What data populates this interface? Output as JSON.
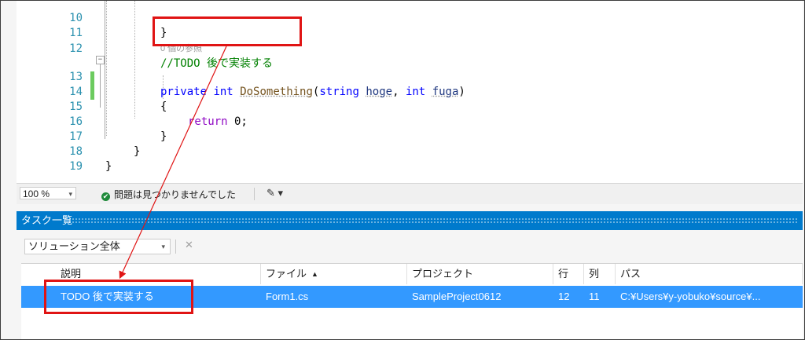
{
  "editor": {
    "lines": [
      {
        "num": "10",
        "code": "}"
      },
      {
        "num": "11",
        "code": ""
      },
      {
        "num": "12",
        "comment": "//TODO 後で実装する"
      },
      {
        "num": "13",
        "kw1": "private",
        "kw2": "int",
        "fn": "DoSomething",
        "open": "(",
        "t1": "string",
        "p1": "hoge",
        "comma": ",",
        "t2": "int",
        "p2": "fuga",
        "close": ")"
      },
      {
        "num": "14",
        "code": "{"
      },
      {
        "num": "15",
        "ret": "return",
        "val": " 0;"
      },
      {
        "num": "16",
        "code": "}"
      },
      {
        "num": "17",
        "code": "}"
      },
      {
        "num": "18",
        "code": "}"
      },
      {
        "num": "19",
        "code": ""
      }
    ],
    "codelens": "0 個の参照",
    "fold_toggle": "−"
  },
  "statusbar": {
    "zoom": "100 %",
    "zoom_arrow": "▾",
    "ok_glyph": "✔",
    "message": "問題は見つかりませんでした",
    "brush_glyph": "✎ ▾"
  },
  "task_list": {
    "title": "タスク一覧",
    "scope": "ソリューション全体",
    "scope_arrow": "▾",
    "clear_filter_glyph": "✕",
    "columns": [
      "説明",
      "ファイル",
      "プロジェクト",
      "行",
      "列",
      "パス"
    ],
    "sort_glyph": "▲",
    "rows": [
      {
        "description": "TODO 後で実装する",
        "file": "Form1.cs",
        "project": "SampleProject0612",
        "line": "12",
        "column": "11",
        "path": "C:¥Users¥y-yobuko¥source¥..."
      }
    ]
  },
  "colors": {
    "annotation": "#e01414",
    "header": "#007acc",
    "selection": "#3399ff"
  }
}
